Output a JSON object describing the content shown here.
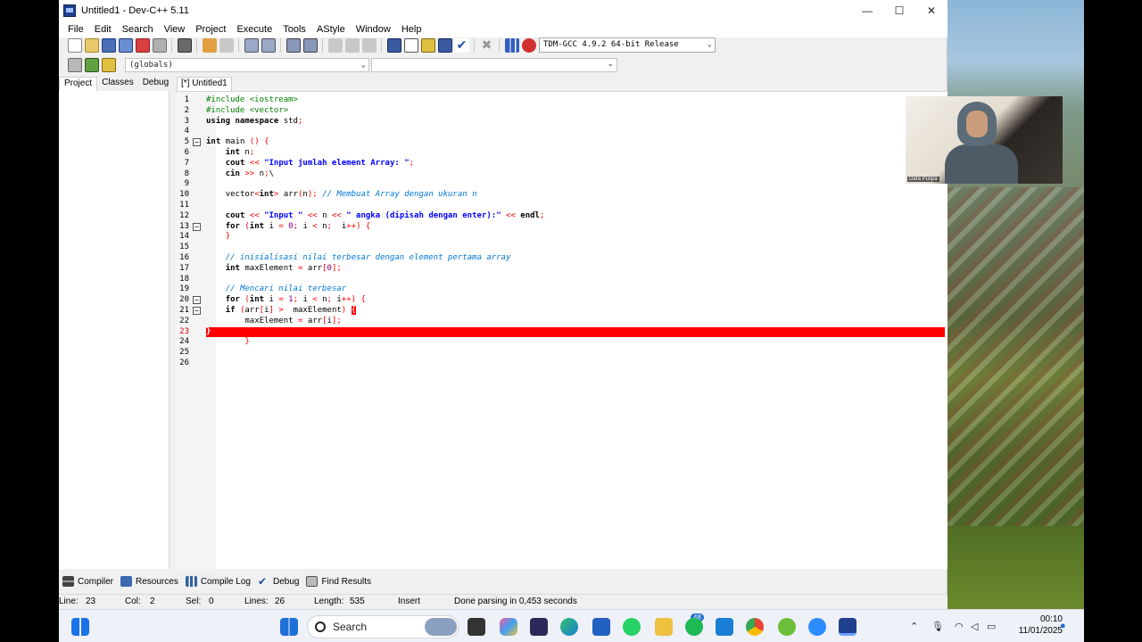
{
  "window": {
    "title": "Untitled1 - Dev-C++ 5.11",
    "controls": {
      "minimize": "—",
      "maximize": "☐",
      "close": "✕"
    }
  },
  "menu": [
    "File",
    "Edit",
    "Search",
    "View",
    "Project",
    "Execute",
    "Tools",
    "AStyle",
    "Window",
    "Help"
  ],
  "toolbar": {
    "compiler": "TDM-GCC 4.9.2 64-bit Release",
    "scope": "(globals)"
  },
  "left_tabs": [
    "Project",
    "Classes",
    "Debug"
  ],
  "editor_tab": "[*] Untitled1",
  "code": {
    "error_line": 23,
    "lines": [
      {
        "n": "1",
        "text": "#include <iostream>"
      },
      {
        "n": "2",
        "text": "#include <vector>"
      },
      {
        "n": "3",
        "text": "using namespace std;"
      },
      {
        "n": "4",
        "text": ""
      },
      {
        "n": "5",
        "text": "int main () {"
      },
      {
        "n": "6",
        "text": "    int n;"
      },
      {
        "n": "7",
        "text": "    cout << \"Input jumlah element Array: \";"
      },
      {
        "n": "8",
        "text": "    cin >> n;\\"
      },
      {
        "n": "9",
        "text": ""
      },
      {
        "n": "10",
        "text": "    vector<int> arr(n); // Membuat Array dengan ukuran n"
      },
      {
        "n": "11",
        "text": ""
      },
      {
        "n": "12",
        "text": "    cout << \"Input \" << n << \" angka (dipisah dengan enter):\" << endl;"
      },
      {
        "n": "13",
        "text": "    for (int i = 0; i < n;  i++) {"
      },
      {
        "n": "14",
        "text": "    }"
      },
      {
        "n": "15",
        "text": ""
      },
      {
        "n": "16",
        "text": "    // inisialisasi nilai terbesar dengan element pertama array"
      },
      {
        "n": "17",
        "text": "    int maxElement = arr[0];"
      },
      {
        "n": "18",
        "text": ""
      },
      {
        "n": "19",
        "text": "    // Mencari nilai terbesar"
      },
      {
        "n": "20",
        "text": "    for (int i = 1; i < n; i++) {"
      },
      {
        "n": "21",
        "text": "    if (arr[i] >  maxElement) {"
      },
      {
        "n": "22",
        "text": "        maxElement = arr[i];"
      },
      {
        "n": "23",
        "text": "}"
      },
      {
        "n": "24",
        "text": "        }"
      },
      {
        "n": "25",
        "text": ""
      },
      {
        "n": "26",
        "text": ""
      }
    ]
  },
  "bottom_tabs": [
    "Compiler",
    "Resources",
    "Compile Log",
    "Debug",
    "Find Results"
  ],
  "status": {
    "line": "Line:",
    "line_val": "23",
    "col": "Col:",
    "col_val": "2",
    "sel": "Sel:",
    "sel_val": "0",
    "lines": "Lines:",
    "lines_val": "26",
    "length": "Length:",
    "length_val": "535",
    "mode": "Insert",
    "message": "Done parsing in 0,453 seconds"
  },
  "webcam": {
    "name": "Dara Puspa"
  },
  "taskbar": {
    "search": "Search",
    "badge": "48",
    "time": "00:10",
    "date": "11/01/2025"
  },
  "colors": {
    "error_highlight": "#ff0000",
    "keyword": "#000000",
    "preprocessor": "#008000",
    "string": "#0000ff",
    "comment": "#0078d7",
    "number": "#800080"
  }
}
